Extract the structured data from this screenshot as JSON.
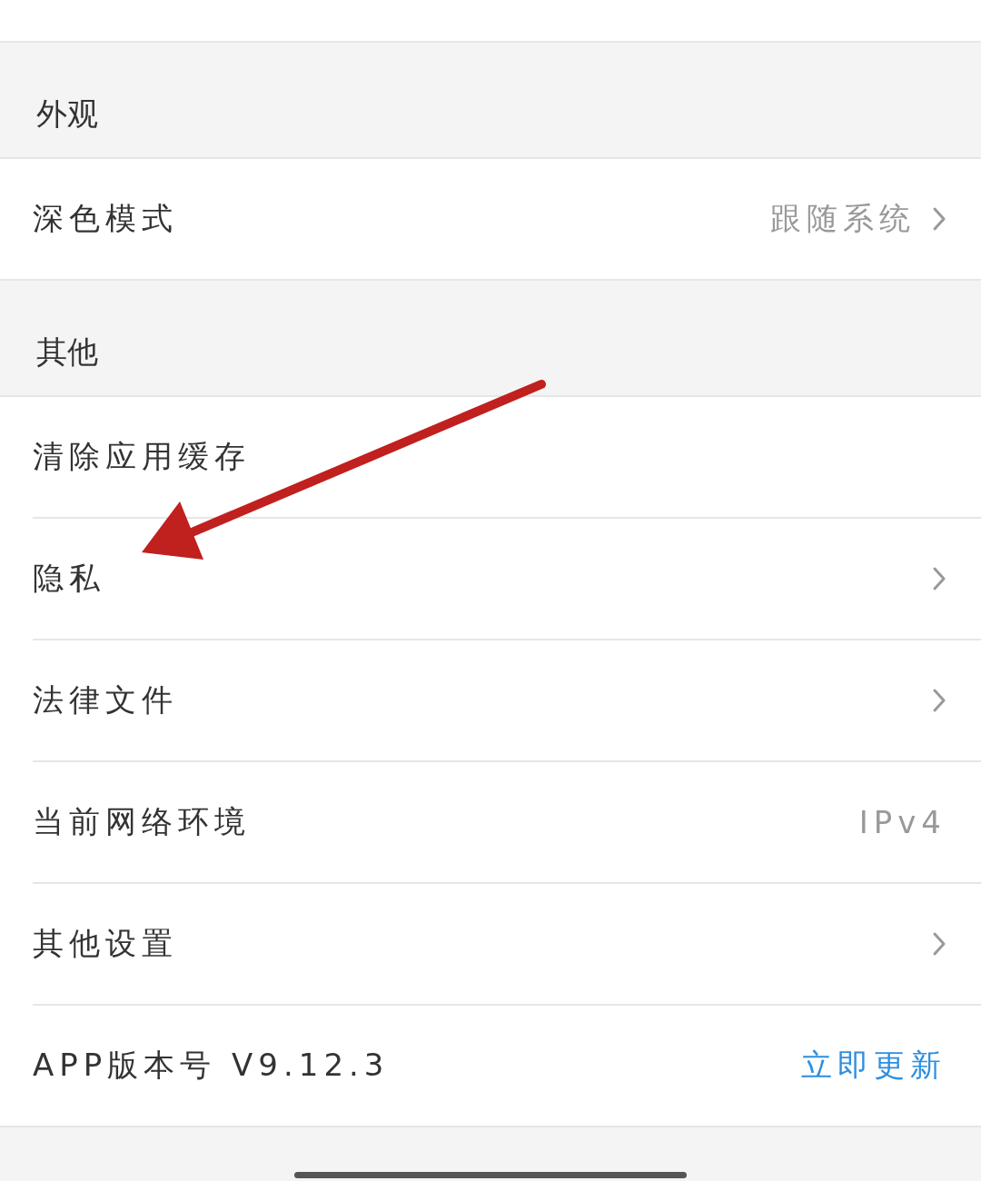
{
  "sections": [
    {
      "title": "外观",
      "rows": [
        {
          "kind": "value",
          "label": "深色模式",
          "value": "跟随系统",
          "chevron": true
        }
      ]
    },
    {
      "title": "其他",
      "rows": [
        {
          "kind": "plain",
          "label": "清除应用缓存",
          "chevron": false
        },
        {
          "kind": "plain",
          "label": "隐私",
          "chevron": true
        },
        {
          "kind": "plain",
          "label": "法律文件",
          "chevron": true
        },
        {
          "kind": "value",
          "label": "当前网络环境",
          "value": "IPv4",
          "chevron": false
        },
        {
          "kind": "plain",
          "label": "其他设置",
          "chevron": true
        },
        {
          "kind": "link",
          "label": "APP版本号 V9.12.3",
          "value": "立即更新",
          "chevron": false
        }
      ]
    }
  ],
  "annotation": {
    "kind": "arrow"
  }
}
